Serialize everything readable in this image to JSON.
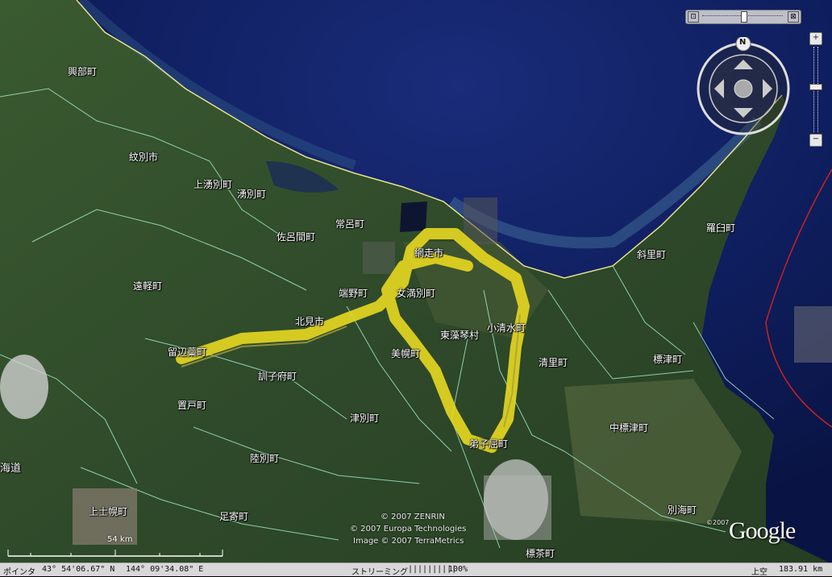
{
  "towns": {
    "okoppe": "興部町",
    "monbetsu": "紋別市",
    "kamiyubetsu": "上湧別町",
    "yubetsu": "湧別町",
    "tokoro": "常呂町",
    "saroma": "佐呂間町",
    "engaru": "遠軽町",
    "abashiri": "網走市",
    "memanbetsu": "女満別町",
    "tanno": "端野町",
    "kitami": "北見市",
    "rubeshibe": "留辺蘂町",
    "higashimokoto": "東藻琴村",
    "koshimizu": "小清水町",
    "bihoro": "美幌町",
    "kiyosato": "清里町",
    "kunneppu": "訓子府町",
    "oketo": "置戸町",
    "tsubetsu": "津別町",
    "teshikaga": "弟子屈町",
    "rikubetsu": "陸別町",
    "kamishihoro": "上士幌町",
    "ashoro": "足寄町",
    "shibecha": "標茶町",
    "shibetsu": "標津町",
    "nakashibetsu": "中標津町",
    "betsukai": "別海町",
    "shari": "斜里町",
    "rausu": "羅臼町",
    "hokkaido": "海道"
  },
  "copyright": {
    "zenrin": "© 2007 ZENRIN",
    "europa": "© 2007 Europa Technologies",
    "image": "Image © 2007 TerraMetrics",
    "google_year": "©2007",
    "google_logo": "Google"
  },
  "scale_label": "54 km",
  "compass_north": "N",
  "status": {
    "pointer_label": "ポインタ",
    "lat": "43° 54'06.67\" N",
    "lon": "144° 09'34.08\" E",
    "streaming_label": "ストリーミング",
    "streaming_bars": "||||||||||",
    "streaming_pct": "100%",
    "alt_label": "上空",
    "alt_value": "183.91 km"
  },
  "controls": {
    "zoom_in": "+",
    "zoom_out": "−"
  }
}
